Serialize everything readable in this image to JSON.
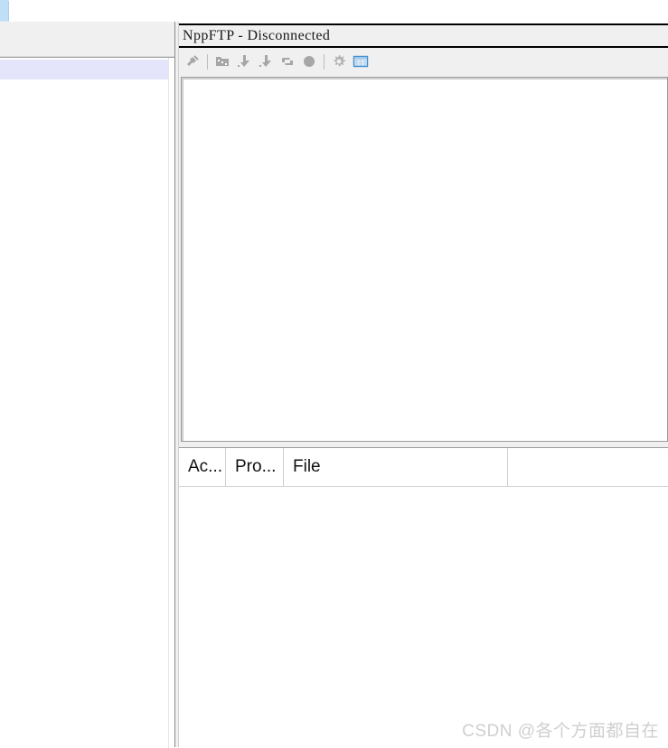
{
  "editor": {
    "tab_label": "",
    "caret_line_text": ""
  },
  "nppftp": {
    "title": "NppFTP - Disconnected",
    "toolbar": [
      {
        "name": "connect-icon",
        "label": "Connect",
        "type": "plug"
      },
      {
        "name": "separator",
        "label": "",
        "type": "sep"
      },
      {
        "name": "open-dir-icon",
        "label": "Open Directory",
        "type": "folder"
      },
      {
        "name": "download-icon",
        "label": "Download",
        "type": "download"
      },
      {
        "name": "upload-icon",
        "label": "Upload",
        "type": "upload"
      },
      {
        "name": "refresh-icon",
        "label": "Refresh",
        "type": "refresh"
      },
      {
        "name": "abort-icon",
        "label": "Abort",
        "type": "abort"
      },
      {
        "name": "separator",
        "label": "",
        "type": "sep"
      },
      {
        "name": "settings-gear-icon",
        "label": "Settings",
        "type": "gear"
      },
      {
        "name": "messages-grid-icon",
        "label": "Messages",
        "type": "grid"
      }
    ]
  },
  "queue": {
    "columns": [
      "Ac...",
      "Pro...",
      "File",
      ""
    ],
    "rows": []
  },
  "watermark": {
    "text": "CSDN @各个方面都自在"
  },
  "colors": {
    "toolbar_bg": "#f0f0f0",
    "panel_bg": "#ffffff",
    "caret_line": "#e4e4fb",
    "tab_active": "#bfdff7",
    "icon_gray": "#a6a6a6",
    "grid_icon_blue": "#3f8fd0",
    "watermark": "#cfcfcf"
  }
}
